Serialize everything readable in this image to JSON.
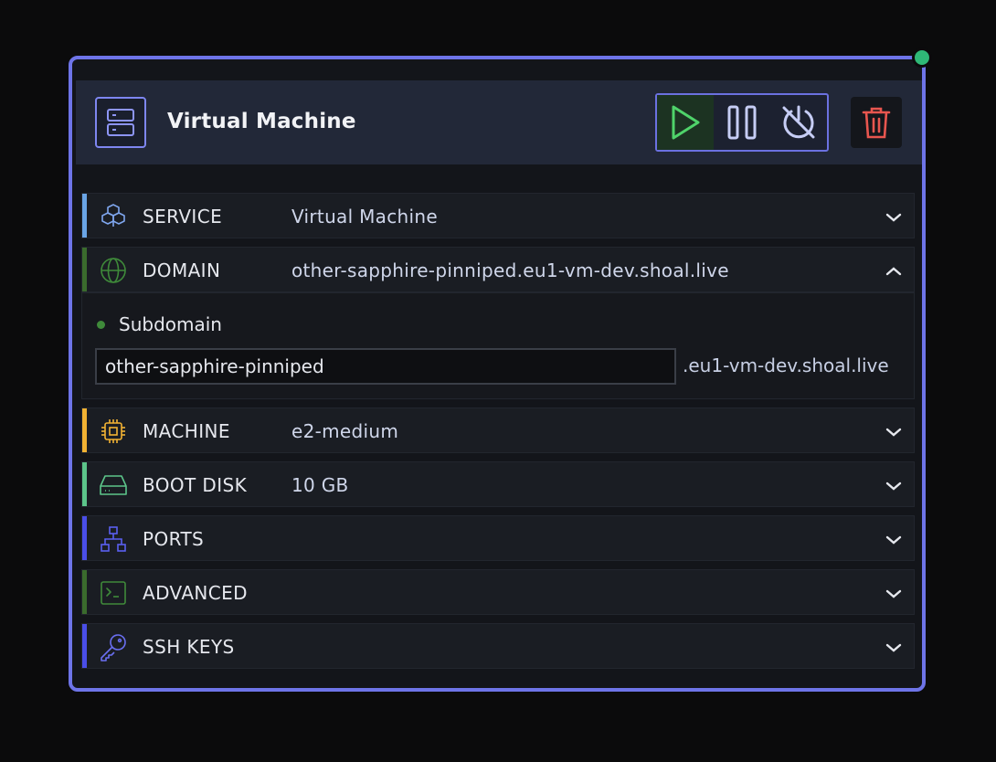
{
  "header": {
    "title": "Virtual Machine",
    "icon": "server-icon",
    "controls": [
      "play-icon",
      "pause-icon",
      "power-off-icon"
    ],
    "delete_icon": "trash-icon"
  },
  "colors": {
    "accent": "#6e74e8",
    "status": "#2fb877",
    "play": "#4fd36a",
    "delete": "#e8564f"
  },
  "rows": [
    {
      "label": "SERVICE",
      "value": "Virtual Machine",
      "icon": "cubes-icon",
      "bar_color": "#6aa5e6",
      "expanded": false
    },
    {
      "label": "DOMAIN",
      "value": "other-sapphire-pinniped.eu1-vm-dev.shoal.live",
      "icon": "globe-icon",
      "bar_color": "#3a6b2d",
      "expanded": true
    },
    {
      "label": "MACHINE",
      "value": "e2-medium",
      "icon": "cpu-icon",
      "bar_color": "#f2b233",
      "expanded": false
    },
    {
      "label": "BOOT DISK",
      "value": "10 GB",
      "icon": "hard-drive-icon",
      "bar_color": "#5cc58a",
      "expanded": false
    },
    {
      "label": "PORTS",
      "value": "",
      "icon": "network-icon",
      "bar_color": "#4a4ee8",
      "expanded": false
    },
    {
      "label": "ADVANCED",
      "value": "",
      "icon": "terminal-icon",
      "bar_color": "#3a6b2d",
      "expanded": false
    },
    {
      "label": "SSH KEYS",
      "value": "",
      "icon": "key-icon",
      "bar_color": "#4a4ee8",
      "expanded": false
    }
  ],
  "subdomain": {
    "label": "Subdomain",
    "value": "other-sapphire-pinniped",
    "suffix": ".eu1-vm-dev.shoal.live"
  }
}
